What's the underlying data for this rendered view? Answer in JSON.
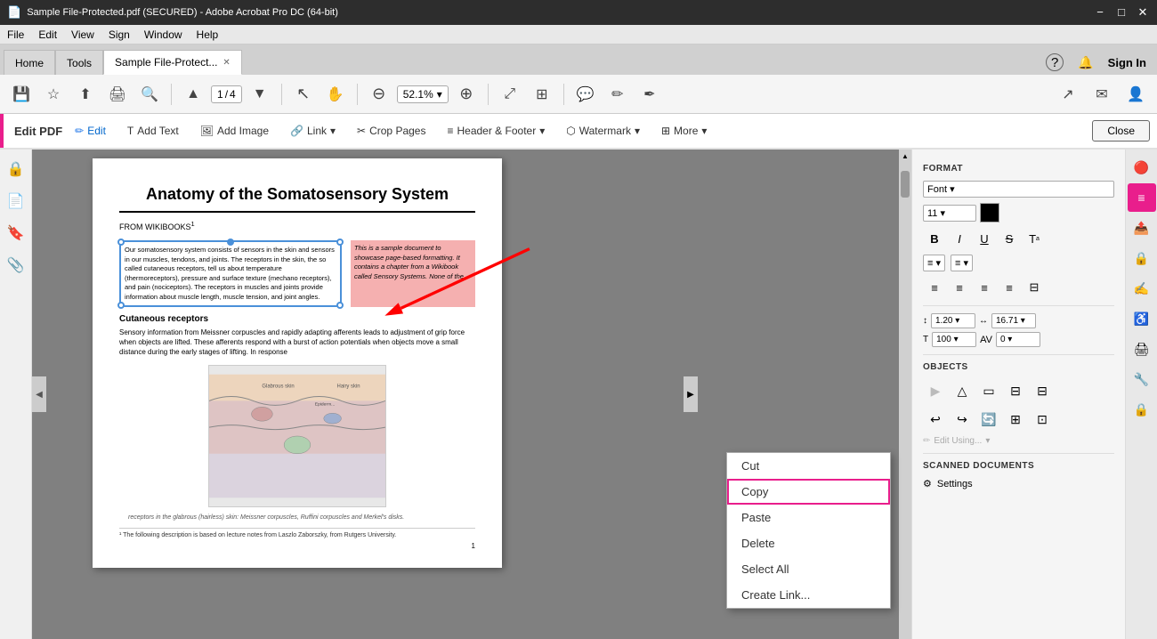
{
  "titleBar": {
    "title": "Sample File-Protected.pdf (SECURED) - Adobe Acrobat Pro DC (64-bit)",
    "iconLabel": "acrobat-icon",
    "minimizeLabel": "−",
    "maximizeLabel": "□",
    "closeLabel": "✕"
  },
  "menuBar": {
    "items": [
      "File",
      "Edit",
      "View",
      "Sign",
      "Window",
      "Help"
    ]
  },
  "tabs": {
    "home": "Home",
    "tools": "Tools",
    "document": "Sample File-Protect...",
    "closeDoc": "✕"
  },
  "tabBarRight": {
    "helpIcon": "?",
    "bellIcon": "🔔",
    "signIn": "Sign In"
  },
  "toolbar": {
    "buttons": [
      {
        "name": "save-btn",
        "icon": "💾"
      },
      {
        "name": "bookmark-btn",
        "icon": "☆"
      },
      {
        "name": "share-btn",
        "icon": "↑"
      },
      {
        "name": "print-btn",
        "icon": "🖨"
      },
      {
        "name": "find-btn",
        "icon": "🔍"
      },
      {
        "name": "prev-page-btn",
        "icon": "▲"
      },
      {
        "name": "next-page-btn",
        "icon": "▼"
      },
      {
        "name": "select-btn",
        "icon": "↖"
      },
      {
        "name": "hand-btn",
        "icon": "✋"
      },
      {
        "name": "zoom-out-btn",
        "icon": "⊖"
      },
      {
        "name": "zoom-in-btn",
        "icon": "⊕"
      },
      {
        "name": "fit-page-btn",
        "icon": "⤢"
      },
      {
        "name": "tools-btn",
        "icon": "⊞"
      },
      {
        "name": "comment-btn",
        "icon": "💬"
      },
      {
        "name": "pencil-btn",
        "icon": "✏"
      },
      {
        "name": "markup-btn",
        "icon": "✒"
      }
    ],
    "pageNum": "1",
    "pageTotal": "4",
    "zoomLevel": "52.1%",
    "shareIcon": "↗",
    "mailIcon": "✉",
    "addUserIcon": "👤"
  },
  "editBar": {
    "label": "Edit PDF",
    "edit": "Edit",
    "addText": "Add Text",
    "addImage": "Add Image",
    "link": "Link",
    "cropPages": "Crop Pages",
    "headerFooter": "Header & Footer",
    "watermark": "Watermark",
    "more": "More",
    "close": "Close"
  },
  "leftSidebar": {
    "icons": [
      {
        "name": "lock-icon",
        "symbol": "🔒"
      },
      {
        "name": "pages-icon",
        "symbol": "📄"
      },
      {
        "name": "bookmark-sidebar-icon",
        "symbol": "🔖"
      },
      {
        "name": "comment-sidebar-icon",
        "symbol": "📎"
      }
    ]
  },
  "pdfContent": {
    "title": "Anatomy of the Somatosensory System",
    "source": "FROM WIKIBOOKS",
    "superscript": "1",
    "bodyText": "Our somatosensory system consists of sensors in the skin and sensors in our muscles, tendons, and joints. The receptors in the skin, the so called cutaneous receptors, tell us about temperature (thermoreceptors), pressure and surface texture (mechano receptors), and pain (nociceptors). The receptors in muscles and joints provide information about muscle length, muscle tension, and joint angles.",
    "sideNote": "This is a sample document to showcase page-based formatting. It contains a chapter from a Wikibook called Sensory Systems. None of the",
    "sectionTitle": "Cutaneous receptors",
    "sectionBody": "Sensory information from Meissner corpuscles and rapidly adapting afferents leads to adjustment of grip force when objects are lifted. These afferents respond with a burst of action potentials when objects move a small distance during the early stages of lifting. In response",
    "figureCaption": "receptors in the glabrous (hairless) skin: Meissner corpuscles, Ruffini corpuscles and Merkel's disks.",
    "footnote": "¹ The following description is based on lecture notes from Laszlo Zaborszky, from Rutgers University.",
    "pageNum": "1"
  },
  "contextMenu": {
    "items": [
      {
        "label": "Cut",
        "name": "cut-menu-item",
        "disabled": false
      },
      {
        "label": "Copy",
        "name": "copy-menu-item",
        "disabled": false,
        "highlighted": true
      },
      {
        "label": "Paste",
        "name": "paste-menu-item",
        "disabled": false
      },
      {
        "label": "Delete",
        "name": "delete-menu-item",
        "disabled": false
      },
      {
        "label": "Select All",
        "name": "select-all-menu-item",
        "disabled": false
      },
      {
        "label": "Create Link...",
        "name": "create-link-menu-item",
        "disabled": false
      }
    ]
  },
  "rightPanel": {
    "formatTitle": "FORMAT",
    "fontSize": "11",
    "fontSizeDropdown": "▾",
    "textStyles": [
      "B",
      "I",
      "U",
      "S",
      "T"
    ],
    "listOptions": [
      "≡",
      "▾",
      "≡",
      "▾"
    ],
    "alignOptions": [
      "≡",
      "≡",
      "≡",
      "≡",
      "⊟"
    ],
    "spacingLabel1": "1.20",
    "spacingLabel2": "16.71",
    "spacingLabel1Prefix": "↕",
    "spacingLabel2Prefix": "↔",
    "percentLabel": "100",
    "avLabel": "AV",
    "avValue": "0",
    "objectsTitle": "OBJECTS",
    "objButtons": [
      "▶",
      "△",
      "▭",
      "⊟",
      "↩",
      "↪",
      "🖼",
      "⊡",
      "⊞"
    ],
    "editUsing": "Edit Using...",
    "scannedTitle": "SCANNED DOCUMENTS",
    "settingsLabel": "Settings"
  }
}
